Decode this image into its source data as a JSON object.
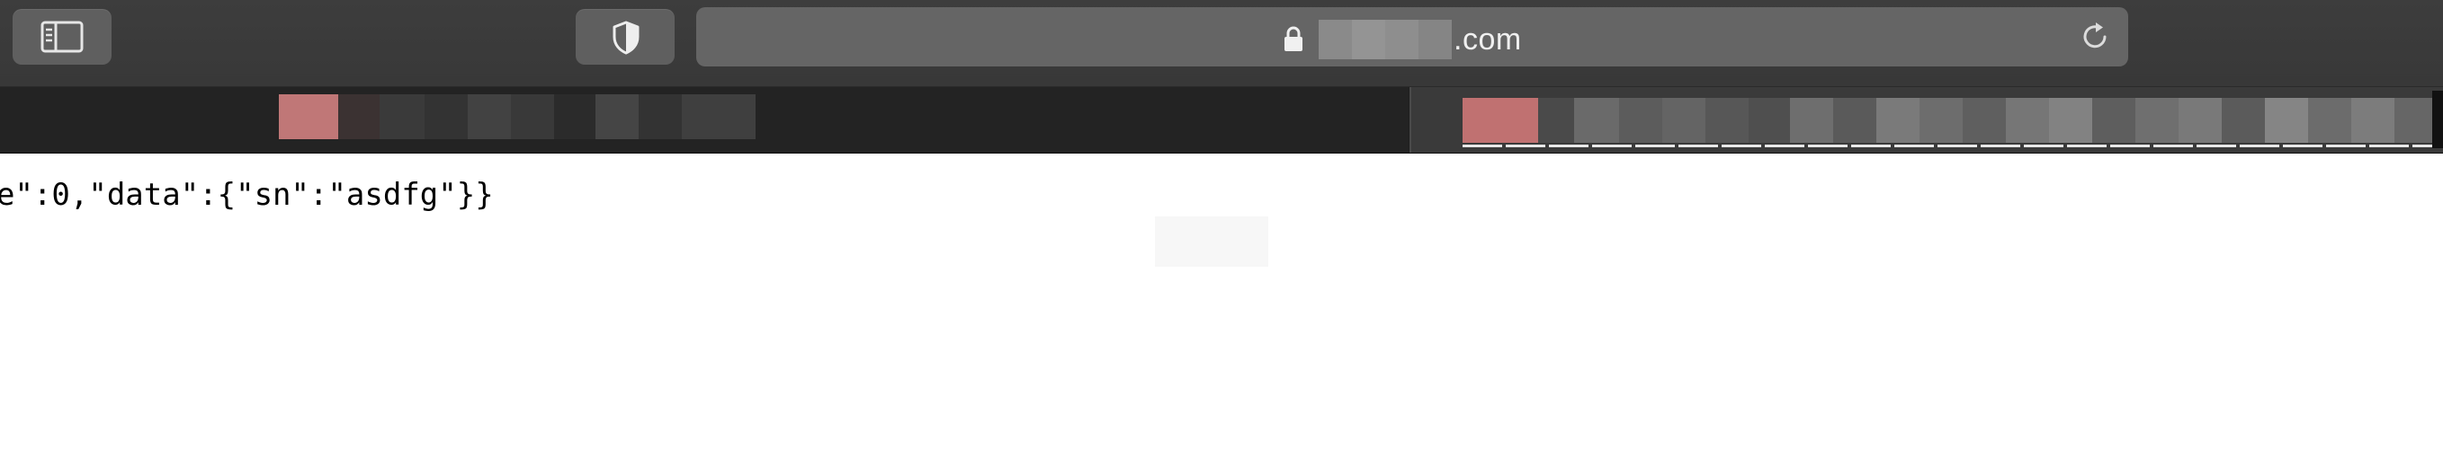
{
  "toolbar": {
    "sidebar_button_icon": "sidebar-icon",
    "privacy_button_icon": "shield-icon",
    "address_bar": {
      "secure_icon": "lock-icon",
      "url_suffix": ".com",
      "reload_icon": "reload-icon"
    }
  },
  "tabs": [
    {
      "active": false,
      "accent_color": "#c07777"
    },
    {
      "active": true,
      "accent_color": "#c07171"
    }
  ],
  "page": {
    "body_text": "e\":0,\"data\":{\"sn\":\"asdfg\"}}"
  }
}
